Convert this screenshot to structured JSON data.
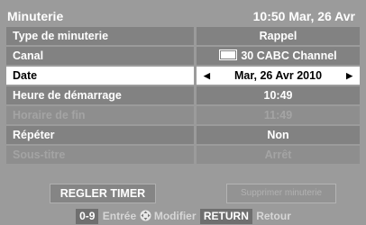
{
  "header": {
    "title": "Minuterie",
    "datetime": "10:50 Mar, 26 Avr"
  },
  "rows": [
    {
      "label": "Type de minuterie",
      "value": "Rappel"
    },
    {
      "label": "Canal",
      "value": "30 CABC Channel"
    },
    {
      "label": "Date",
      "value": "Mar, 26 Avr 2010"
    },
    {
      "label": "Heure de démarrage",
      "value": "10:49"
    },
    {
      "label": "Horaire de fin",
      "value": "11:49"
    },
    {
      "label": "Répéter",
      "value": "Non"
    },
    {
      "label": "Sous-titre",
      "value": "Arrêt"
    }
  ],
  "buttons": {
    "set_timer": "REGLER TIMER",
    "delete_timer": "Supprimer minuterie"
  },
  "footer": {
    "key_digits": "0-9",
    "text_enter": "Entrée",
    "text_modify": "Modifier",
    "key_return": "RETURN",
    "text_back": "Retour"
  },
  "icons": {
    "left_arrow": "left-arrow-icon",
    "right_arrow": "right-arrow-icon",
    "dpad": "dpad-icon",
    "channel": "channel-icon"
  },
  "colors": {
    "background": "#9b9b9b",
    "row": "#828282",
    "selected": "#ffffff",
    "text": "#ffffff"
  }
}
